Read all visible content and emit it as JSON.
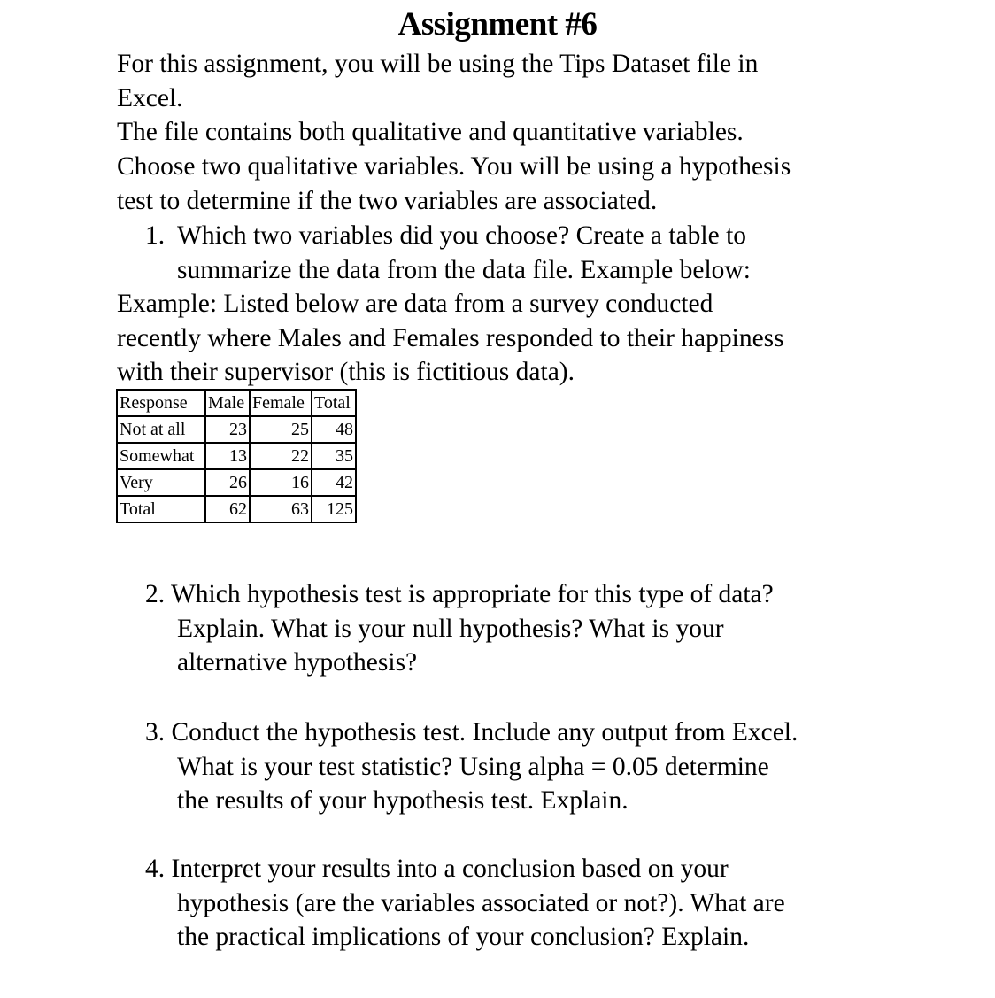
{
  "document": {
    "title": "Assignment #6",
    "intro_lines": [
      "For this assignment, you will be using the Tips Dataset file in",
      "Excel.",
      "The file contains both qualitative and quantitative variables.",
      "Choose two qualitative variables. You will be using a hypothesis",
      "test to determine if the two variables are associated."
    ],
    "questions": [
      {
        "number": "1.",
        "lines": [
          "Which two variables did you choose? Create a table to",
          "summarize the data from the data file. Example below:"
        ]
      },
      {
        "number": "2.",
        "lines": [
          "Which hypothesis test is appropriate for this type of data?",
          "Explain. What is your null hypothesis? What is your",
          "alternative hypothesis?"
        ]
      },
      {
        "number": "3.",
        "lines": [
          "Conduct the hypothesis test. Include any output from Excel.",
          "What is your test statistic? Using alpha = 0.05 determine",
          "the results of your hypothesis test. Explain."
        ]
      },
      {
        "number": "4.",
        "lines": [
          "Interpret your results into a conclusion based on your",
          "hypothesis (are the variables associated or not?). What are",
          "the practical implications of your conclusion? Explain."
        ]
      }
    ],
    "example_lines": [
      "Example: Listed below are data from a survey conducted",
      "recently where Males and Females responded to their happiness",
      "with their supervisor (this is fictitious data)."
    ]
  },
  "summary_table": {
    "headers": [
      "Response",
      "Male",
      "Female",
      "Total"
    ],
    "rows": [
      [
        "Not at all",
        "23",
        "25",
        "48"
      ],
      [
        "Somewhat",
        "13",
        "22",
        "35"
      ],
      [
        "Very",
        "26",
        "16",
        "42"
      ],
      [
        "Total",
        "62",
        "63",
        "125"
      ]
    ]
  }
}
